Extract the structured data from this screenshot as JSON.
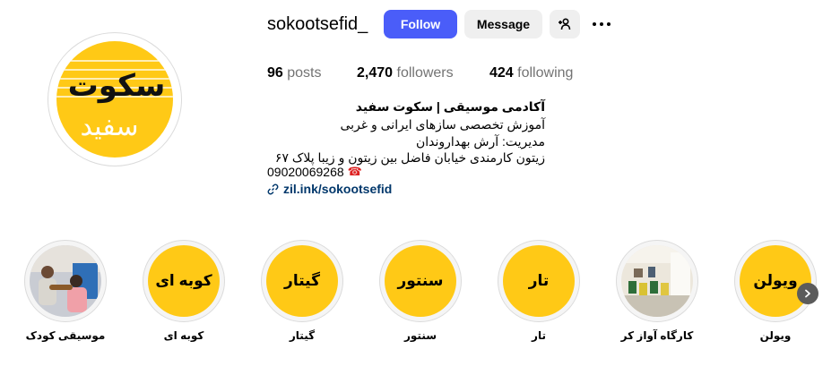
{
  "profile": {
    "username": "sokootsefid_",
    "follow_label": "Follow",
    "message_label": "Message",
    "logo_text_top": "سکوت",
    "logo_text_bottom": "سفید"
  },
  "stats": {
    "posts_count": "96",
    "posts_label": "posts",
    "followers_count": "2,470",
    "followers_label": "followers",
    "following_count": "424",
    "following_label": "following"
  },
  "bio": {
    "title": "آکادمی موسیقی | سکوت سفید",
    "line1": "آموزش تخصصی سازهای ایرانی و غربی",
    "line2": "مدیریت: آرش بهداروندان",
    "line3": "زیتون کارمندی خیابان فاضل بین زیتون و زیبا پلاک ۶۷",
    "phone": "09020069268",
    "link": "zil.ink/sokootsefid"
  },
  "highlights": [
    {
      "label": "موسیقی کودک",
      "inner_text": "",
      "kind": "photo"
    },
    {
      "label": "کوبه ای",
      "inner_text": "کوبه ای",
      "kind": "yellow"
    },
    {
      "label": "گیتار",
      "inner_text": "گیتار",
      "kind": "yellow"
    },
    {
      "label": "سنتور",
      "inner_text": "سنتور",
      "kind": "yellow"
    },
    {
      "label": "تار",
      "inner_text": "تار",
      "kind": "yellow"
    },
    {
      "label": "کارگاه آواز کر",
      "inner_text": "",
      "kind": "photo"
    },
    {
      "label": "ویولن",
      "inner_text": "ویولن",
      "kind": "yellow"
    }
  ],
  "icons": {
    "add_user": "person-add-icon",
    "more": "more-options-icon",
    "phone": "telephone-icon",
    "link": "link-icon",
    "next": "chevron-right-icon"
  },
  "colors": {
    "follow_button": "#4a5df9",
    "secondary_button": "#efefef",
    "brand_yellow": "#ffc916",
    "link": "#00376b",
    "muted_text": "#737373"
  }
}
